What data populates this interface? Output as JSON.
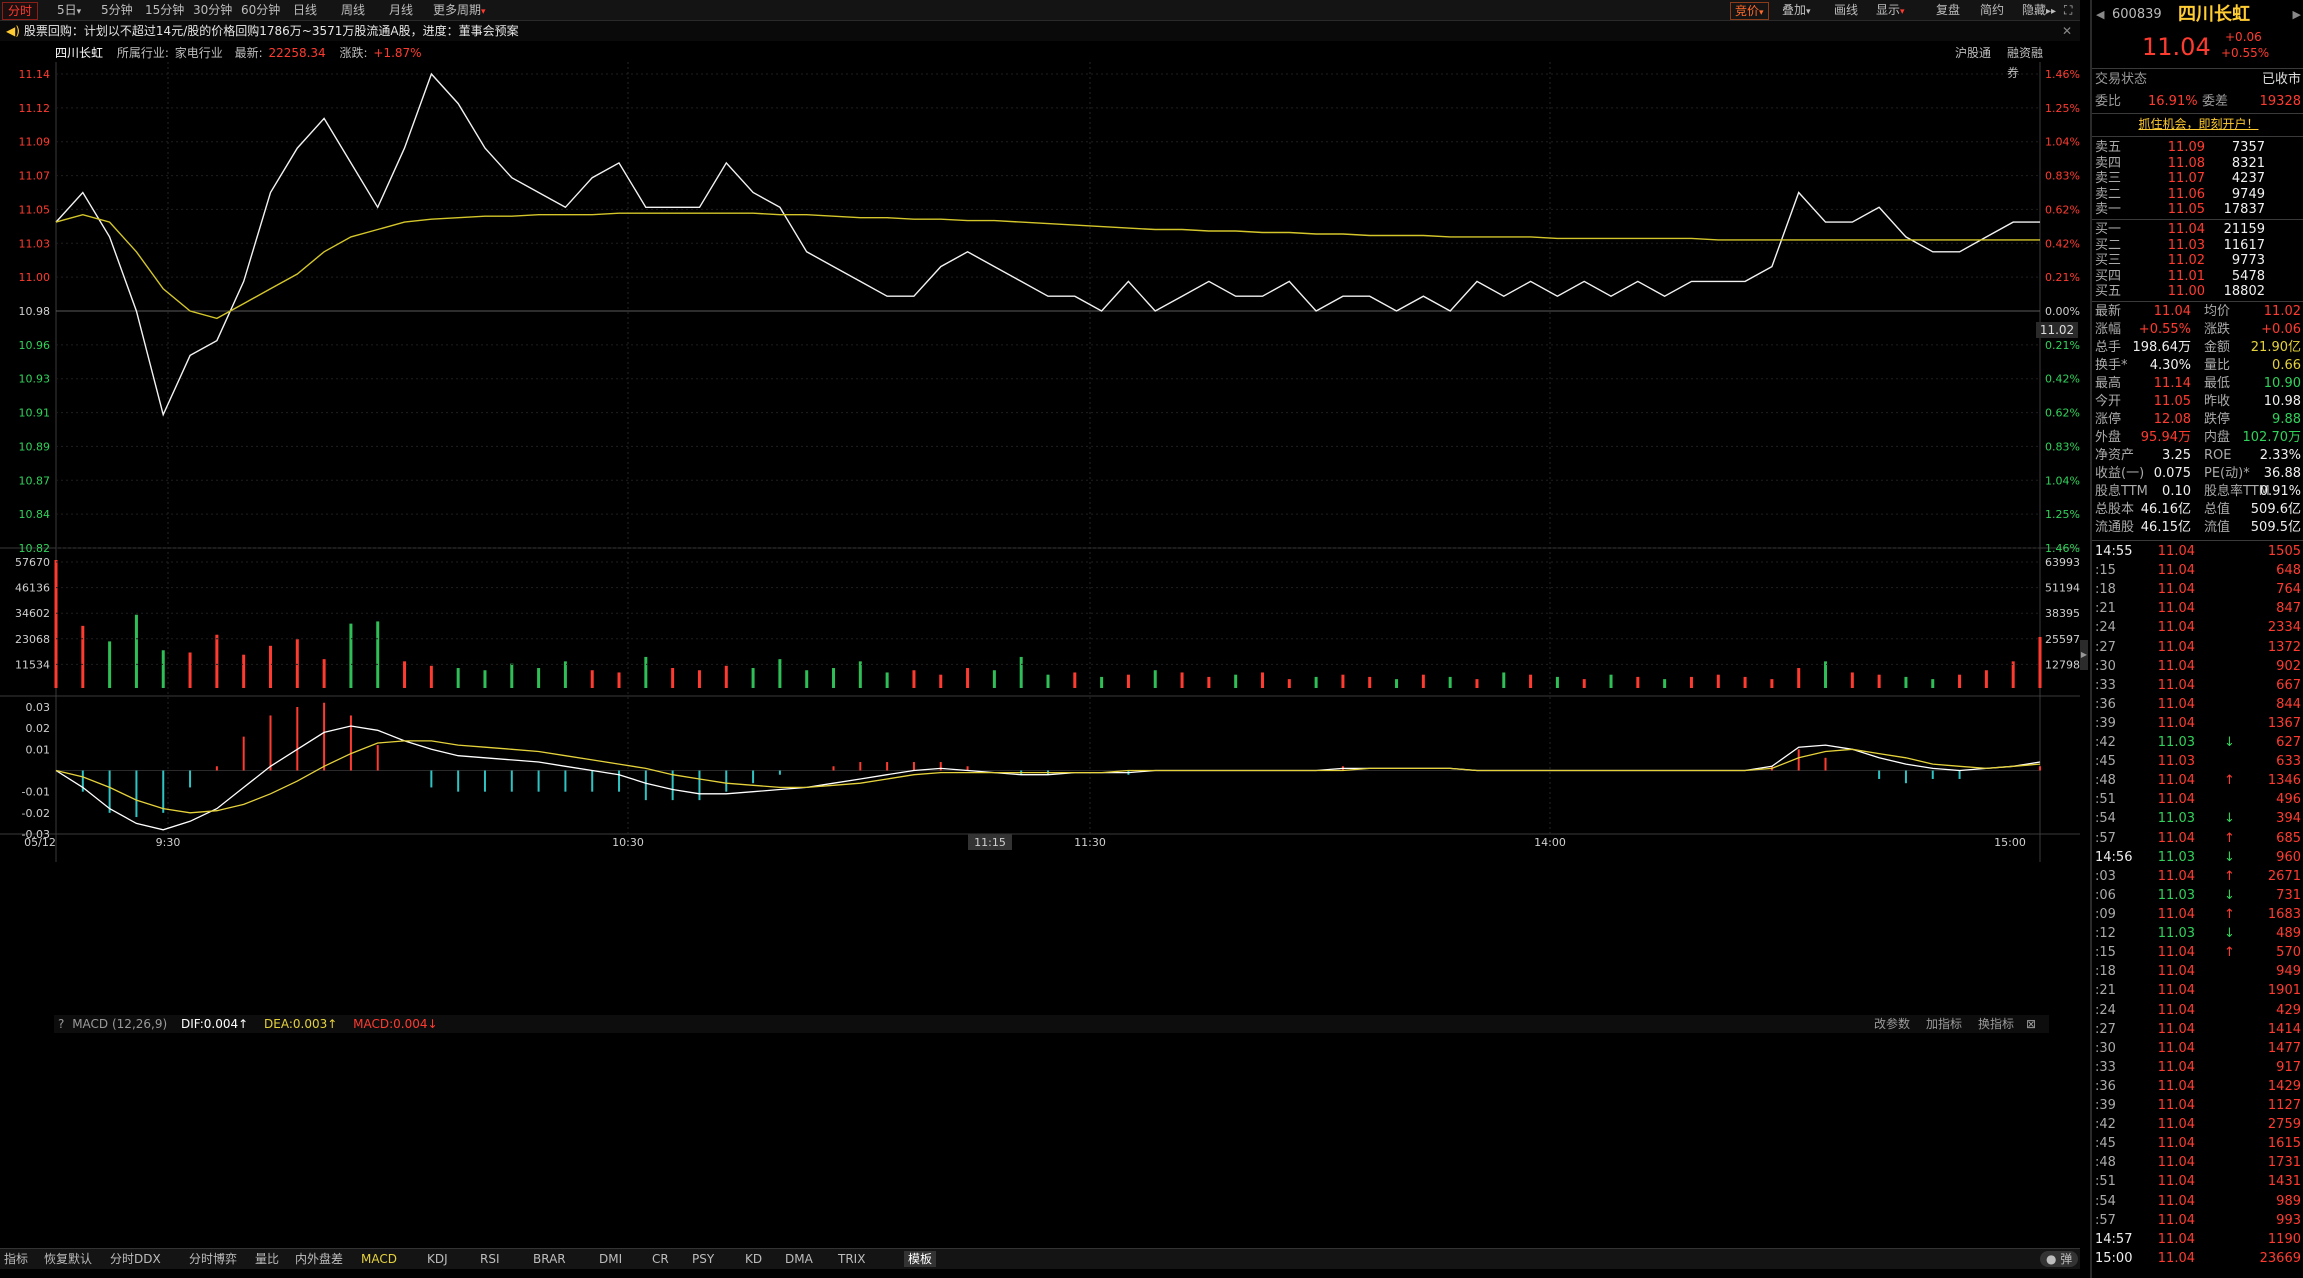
{
  "toolbar": {
    "tabs": [
      "分时",
      "5日",
      "5分钟",
      "15分钟",
      "30分钟",
      "60分钟",
      "日线",
      "周线",
      "月线",
      "更多周期"
    ],
    "right": [
      "竞价",
      "叠加",
      "画线",
      "显示",
      "复盘",
      "简约",
      "隐藏"
    ]
  },
  "notice": "股票回购：计划以不超过14元/股的价格回购1786万~3571万股流通A股，进度：董事会预案",
  "stock_info": {
    "name": "四川长虹",
    "industry_label": "所属行业:",
    "industry": "家电行业",
    "latest_label": "最新:",
    "latest": "22258.34",
    "change_label": "涨跌:",
    "change": "+1.87%",
    "links": [
      "沪股通",
      "融资融券"
    ]
  },
  "chart_data": [
    {
      "type": "line",
      "name": "price",
      "x": [
        "09:30",
        "09:31",
        "09:32",
        "09:33",
        "09:34",
        "09:35",
        "09:36",
        "09:37",
        "09:38",
        "09:39",
        "09:40",
        "09:41",
        "09:42",
        "09:43",
        "09:44",
        "09:45",
        "09:46",
        "09:47",
        "09:48",
        "09:49",
        "09:50",
        "09:51",
        "09:52",
        "09:53",
        "09:55",
        "09:57",
        "09:59",
        "10:01",
        "10:03",
        "10:05",
        "10:07",
        "10:09",
        "10:11",
        "10:13",
        "10:15",
        "10:17",
        "10:20",
        "10:25",
        "10:30",
        "10:35",
        "10:40",
        "10:45",
        "10:50",
        "10:55",
        "11:00",
        "11:05",
        "11:10",
        "11:15",
        "11:20",
        "11:25",
        "11:30",
        "13:05",
        "13:10",
        "13:15",
        "13:20",
        "13:25",
        "13:30",
        "13:35",
        "13:40",
        "13:45",
        "13:50",
        "13:55",
        "14:00",
        "14:05",
        "14:10",
        "14:15",
        "14:20",
        "14:25",
        "14:30",
        "14:35",
        "14:40",
        "14:45",
        "14:50",
        "14:55",
        "15:00"
      ],
      "series": [
        {
          "name": "price",
          "values": [
            11.04,
            11.06,
            11.03,
            10.98,
            10.91,
            10.95,
            10.96,
            11.0,
            11.06,
            11.09,
            11.11,
            11.08,
            11.05,
            11.09,
            11.14,
            11.12,
            11.09,
            11.07,
            11.06,
            11.05,
            11.07,
            11.08,
            11.05,
            11.05,
            11.05,
            11.08,
            11.06,
            11.05,
            11.02,
            11.01,
            11.0,
            10.99,
            10.99,
            11.01,
            11.02,
            11.01,
            11.0,
            10.99,
            10.99,
            10.98,
            11.0,
            10.98,
            10.99,
            11.0,
            10.99,
            10.99,
            11.0,
            10.98,
            10.99,
            10.99,
            10.98,
            10.99,
            10.98,
            11.0,
            10.99,
            11.0,
            10.99,
            11.0,
            10.99,
            11.0,
            10.99,
            11.0,
            11.0,
            11.0,
            11.01,
            11.06,
            11.04,
            11.04,
            11.05,
            11.03,
            11.02,
            11.02,
            11.03,
            11.04,
            11.04
          ]
        },
        {
          "name": "average",
          "values": [
            11.04,
            11.045,
            11.04,
            11.02,
            10.995,
            10.98,
            10.975,
            10.985,
            10.995,
            11.005,
            11.02,
            11.03,
            11.035,
            11.04,
            11.042,
            11.043,
            11.044,
            11.044,
            11.045,
            11.045,
            11.045,
            11.046,
            11.046,
            11.046,
            11.046,
            11.046,
            11.046,
            11.045,
            11.045,
            11.044,
            11.043,
            11.043,
            11.042,
            11.042,
            11.041,
            11.041,
            11.04,
            11.039,
            11.038,
            11.037,
            11.036,
            11.035,
            11.035,
            11.034,
            11.034,
            11.033,
            11.033,
            11.032,
            11.032,
            11.031,
            11.031,
            11.031,
            11.03,
            11.03,
            11.03,
            11.03,
            11.029,
            11.029,
            11.029,
            11.029,
            11.029,
            11.029,
            11.028,
            11.028,
            11.028,
            11.028,
            11.028,
            11.028,
            11.028,
            11.028,
            11.028,
            11.028,
            11.028,
            11.028,
            11.028
          ]
        }
      ],
      "ylim": [
        10.82,
        11.14
      ],
      "prev_close": 10.98,
      "yticks_left": [
        "11.14",
        "11.12",
        "11.09",
        "11.07",
        "11.05",
        "11.03",
        "11.00",
        "10.98",
        "10.96",
        "10.93",
        "10.91",
        "10.89",
        "10.87",
        "10.84",
        "10.82"
      ],
      "yticks_right": [
        "1.46%",
        "1.25%",
        "1.04%",
        "0.83%",
        "0.62%",
        "0.42%",
        "0.21%",
        "0.00%",
        "0.21%",
        "0.42%",
        "0.62%",
        "0.83%",
        "1.04%",
        "1.25%",
        "1.46%"
      ],
      "xticks": [
        "05/12",
        "9:30",
        "10:30",
        "11:15",
        "11:30",
        "14:00",
        "15:00"
      ],
      "last_price_label": "11.02"
    },
    {
      "type": "bar",
      "name": "volume",
      "yticks_left": [
        "57670",
        "46136",
        "34602",
        "23068",
        "11534"
      ],
      "yticks_right": [
        "63993",
        "51194",
        "38395",
        "25597",
        "12798"
      ],
      "ylim": [
        0,
        57670
      ],
      "values": [
        57670,
        28000,
        21000,
        33000,
        17000,
        16000,
        24000,
        15000,
        19000,
        22000,
        13000,
        29000,
        30000,
        12000,
        10000,
        9000,
        8000,
        11000,
        9000,
        12000,
        8000,
        7000,
        14000,
        9000,
        8000,
        10000,
        9000,
        13000,
        8000,
        9000,
        12000,
        7000,
        8000,
        6000,
        9000,
        8000,
        14000,
        6000,
        7000,
        5000,
        6000,
        8000,
        7000,
        5000,
        6000,
        7000,
        4000,
        5000,
        6000,
        5000,
        4000,
        6000,
        5000,
        4000,
        7000,
        6000,
        5000,
        4000,
        6000,
        5000,
        4000,
        5000,
        6000,
        5000,
        4000,
        9000,
        12000,
        7000,
        6000,
        5000,
        4000,
        6000,
        8000,
        12000,
        23000
      ]
    },
    {
      "type": "line",
      "name": "MACD",
      "indicator_label": "MACD (12,26,9)",
      "dif_label": "DIF:0.004↑",
      "dea_label": "DEA:0.003↑",
      "macd_label": "MACD:0.004↓",
      "actions": [
        "改参数",
        "加指标",
        "换指标"
      ],
      "ylim": [
        -0.03,
        0.03
      ],
      "yticks": [
        "0.03",
        "0.02",
        "0.01",
        "-0.01",
        "-0.02",
        "-0.03"
      ],
      "series": [
        {
          "name": "DIF",
          "values": [
            0,
            -0.008,
            -0.018,
            -0.025,
            -0.028,
            -0.024,
            -0.018,
            -0.008,
            0.002,
            0.01,
            0.018,
            0.021,
            0.019,
            0.014,
            0.01,
            0.007,
            0.006,
            0.005,
            0.004,
            0.002,
            0.0,
            -0.002,
            -0.006,
            -0.009,
            -0.011,
            -0.011,
            -0.01,
            -0.009,
            -0.008,
            -0.006,
            -0.004,
            -0.002,
            0.0,
            0.001,
            0.0,
            -0.001,
            -0.002,
            -0.002,
            -0.001,
            -0.001,
            -0.001,
            0.0,
            0.0,
            0.0,
            0.0,
            0.0,
            0.0,
            0.0,
            0.001,
            0.001,
            0.001,
            0.001,
            0.001,
            0.0,
            0.0,
            0.0,
            0.0,
            0.0,
            0.0,
            0.0,
            0.0,
            0.0,
            0.0,
            0.0,
            0.002,
            0.011,
            0.012,
            0.01,
            0.006,
            0.003,
            0.001,
            0.0,
            0.001,
            0.002,
            0.004
          ]
        },
        {
          "name": "DEA",
          "values": [
            0,
            -0.003,
            -0.008,
            -0.014,
            -0.018,
            -0.02,
            -0.019,
            -0.016,
            -0.011,
            -0.005,
            0.002,
            0.008,
            0.013,
            0.014,
            0.014,
            0.012,
            0.011,
            0.01,
            0.009,
            0.007,
            0.005,
            0.003,
            0.001,
            -0.002,
            -0.004,
            -0.006,
            -0.007,
            -0.008,
            -0.008,
            -0.007,
            -0.006,
            -0.004,
            -0.002,
            -0.001,
            -0.001,
            -0.001,
            -0.001,
            -0.001,
            -0.001,
            -0.001,
            0.0,
            0.0,
            0.0,
            0.0,
            0.0,
            0.0,
            0.0,
            0.0,
            0.0,
            0.001,
            0.001,
            0.001,
            0.001,
            0.0,
            0.0,
            0.0,
            0.0,
            0.0,
            0.0,
            0.0,
            0.0,
            0.0,
            0.0,
            0.0,
            0.001,
            0.006,
            0.009,
            0.01,
            0.008,
            0.006,
            0.003,
            0.002,
            0.001,
            0.002,
            0.003
          ]
        }
      ]
    }
  ],
  "bottom_tabs": [
    "指标",
    "恢复默认",
    "分时DDX",
    "分时博弈",
    "量比",
    "内外盘差",
    "MACD",
    "KDJ",
    "RSI",
    "BRAR",
    "DMI",
    "CR",
    "PSY",
    "KD",
    "DMA",
    "TRIX",
    "模板"
  ],
  "right_panel": {
    "code": "600839",
    "name": "四川长虹",
    "price": "11.04",
    "change": "+0.06",
    "change_pct": "+0.55%",
    "status_label": "交易状态",
    "status": "已收市",
    "ratio_label": "委比",
    "ratio": "16.91%",
    "diff_label": "委差",
    "diff": "19328",
    "promo": "抓住机会，即刻开户！",
    "asks": [
      {
        "label": "卖五",
        "price": "11.09",
        "vol": "7357"
      },
      {
        "label": "卖四",
        "price": "11.08",
        "vol": "8321"
      },
      {
        "label": "卖三",
        "price": "11.07",
        "vol": "4237"
      },
      {
        "label": "卖二",
        "price": "11.06",
        "vol": "9749"
      },
      {
        "label": "卖一",
        "price": "11.05",
        "vol": "17837"
      }
    ],
    "bids": [
      {
        "label": "买一",
        "price": "11.04",
        "vol": "21159"
      },
      {
        "label": "买二",
        "price": "11.03",
        "vol": "11617"
      },
      {
        "label": "买三",
        "price": "11.02",
        "vol": "9773"
      },
      {
        "label": "买四",
        "price": "11.01",
        "vol": "5478"
      },
      {
        "label": "买五",
        "price": "11.00",
        "vol": "18802"
      }
    ],
    "stats": [
      {
        "k1": "最新",
        "v1": "11.04",
        "k2": "均价",
        "v2": "11.02",
        "c1": "red",
        "c2": "red"
      },
      {
        "k1": "涨幅",
        "v1": "+0.55%",
        "k2": "涨跌",
        "v2": "+0.06",
        "c1": "red",
        "c2": "red"
      },
      {
        "k1": "总手",
        "v1": "198.64万",
        "k2": "金额",
        "v2": "21.90亿",
        "c1": "white",
        "c2": "yellow"
      },
      {
        "k1": "换手*",
        "v1": "4.30%",
        "k2": "量比",
        "v2": "0.66",
        "c1": "white",
        "c2": "yellow"
      },
      {
        "k1": "最高",
        "v1": "11.14",
        "k2": "最低",
        "v2": "10.90",
        "c1": "red",
        "c2": "green"
      },
      {
        "k1": "今开",
        "v1": "11.05",
        "k2": "昨收",
        "v2": "10.98",
        "c1": "red",
        "c2": "white"
      },
      {
        "k1": "涨停",
        "v1": "12.08",
        "k2": "跌停",
        "v2": "9.88",
        "c1": "red",
        "c2": "green"
      },
      {
        "k1": "外盘",
        "v1": "95.94万",
        "k2": "内盘",
        "v2": "102.70万",
        "c1": "red",
        "c2": "green"
      },
      {
        "k1": "净资产",
        "v1": "3.25",
        "k2": "ROE",
        "v2": "2.33%",
        "c1": "white",
        "c2": "white"
      },
      {
        "k1": "收益(一)",
        "v1": "0.075",
        "k2": "PE(动)*",
        "v2": "36.88",
        "c1": "white",
        "c2": "white"
      },
      {
        "k1": "股息TTM",
        "v1": "0.10",
        "k2": "股息率TTM",
        "v2": "0.91%",
        "c1": "white",
        "c2": "white"
      },
      {
        "k1": "总股本",
        "v1": "46.16亿",
        "k2": "总值",
        "v2": "509.6亿",
        "c1": "white",
        "c2": "white"
      },
      {
        "k1": "流通股",
        "v1": "46.15亿",
        "k2": "流值",
        "v2": "509.5亿",
        "c1": "white",
        "c2": "white"
      }
    ],
    "ticks": [
      {
        "t": "14:55",
        "p": "11.04",
        "v": "1505",
        "a": ""
      },
      {
        "t": ":15",
        "p": "11.04",
        "v": "648",
        "a": ""
      },
      {
        "t": ":18",
        "p": "11.04",
        "v": "764",
        "a": ""
      },
      {
        "t": ":21",
        "p": "11.04",
        "v": "847",
        "a": ""
      },
      {
        "t": ":24",
        "p": "11.04",
        "v": "2334",
        "a": ""
      },
      {
        "t": ":27",
        "p": "11.04",
        "v": "1372",
        "a": ""
      },
      {
        "t": ":30",
        "p": "11.04",
        "v": "902",
        "a": ""
      },
      {
        "t": ":33",
        "p": "11.04",
        "v": "667",
        "a": ""
      },
      {
        "t": ":36",
        "p": "11.04",
        "v": "844",
        "a": ""
      },
      {
        "t": ":39",
        "p": "11.04",
        "v": "1367",
        "a": ""
      },
      {
        "t": ":42",
        "p": "11.03",
        "v": "627",
        "a": "down"
      },
      {
        "t": ":45",
        "p": "11.03",
        "v": "633",
        "a": ""
      },
      {
        "t": ":48",
        "p": "11.04",
        "v": "1346",
        "a": "up"
      },
      {
        "t": ":51",
        "p": "11.04",
        "v": "496",
        "a": ""
      },
      {
        "t": ":54",
        "p": "11.03",
        "v": "394",
        "a": "down"
      },
      {
        "t": ":57",
        "p": "11.04",
        "v": "685",
        "a": "up"
      },
      {
        "t": "14:56",
        "p": "11.03",
        "v": "960",
        "a": "down"
      },
      {
        "t": ":03",
        "p": "11.04",
        "v": "2671",
        "a": "up"
      },
      {
        "t": ":06",
        "p": "11.03",
        "v": "731",
        "a": "down"
      },
      {
        "t": ":09",
        "p": "11.04",
        "v": "1683",
        "a": "up"
      },
      {
        "t": ":12",
        "p": "11.03",
        "v": "489",
        "a": "down"
      },
      {
        "t": ":15",
        "p": "11.04",
        "v": "570",
        "a": "up"
      },
      {
        "t": ":18",
        "p": "11.04",
        "v": "949",
        "a": ""
      },
      {
        "t": ":21",
        "p": "11.04",
        "v": "1901",
        "a": ""
      },
      {
        "t": ":24",
        "p": "11.04",
        "v": "429",
        "a": ""
      },
      {
        "t": ":27",
        "p": "11.04",
        "v": "1414",
        "a": ""
      },
      {
        "t": ":30",
        "p": "11.04",
        "v": "1477",
        "a": ""
      },
      {
        "t": ":33",
        "p": "11.04",
        "v": "917",
        "a": ""
      },
      {
        "t": ":36",
        "p": "11.04",
        "v": "1429",
        "a": ""
      },
      {
        "t": ":39",
        "p": "11.04",
        "v": "1127",
        "a": ""
      },
      {
        "t": ":42",
        "p": "11.04",
        "v": "2759",
        "a": ""
      },
      {
        "t": ":45",
        "p": "11.04",
        "v": "1615",
        "a": ""
      },
      {
        "t": ":48",
        "p": "11.04",
        "v": "1731",
        "a": ""
      },
      {
        "t": ":51",
        "p": "11.04",
        "v": "1431",
        "a": ""
      },
      {
        "t": ":54",
        "p": "11.04",
        "v": "989",
        "a": ""
      },
      {
        "t": ":57",
        "p": "11.04",
        "v": "993",
        "a": ""
      },
      {
        "t": "14:57",
        "p": "11.04",
        "v": "1190",
        "a": ""
      },
      {
        "t": "15:00",
        "p": "11.04",
        "v": "23669",
        "a": ""
      }
    ],
    "colors": {
      "up": "#ff3b30",
      "down": "#31d25b",
      "neutral": "#e6e6e6"
    }
  }
}
